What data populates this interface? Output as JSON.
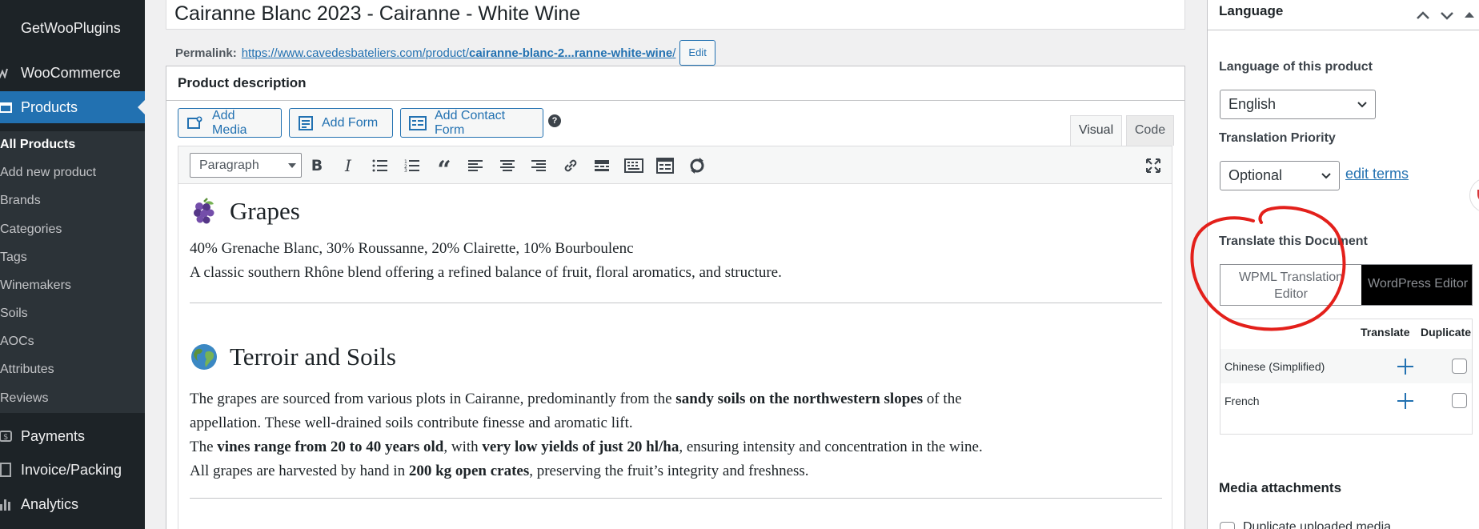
{
  "sidebar": {
    "items": [
      {
        "label": "GetWooPlugins",
        "icon": "getwooplugins-icon"
      },
      {
        "label": "WooCommerce",
        "icon": "woocommerce-icon"
      },
      {
        "label": "Products",
        "icon": "products-icon"
      }
    ],
    "submenu": [
      {
        "label": "All Products"
      },
      {
        "label": "Add new product"
      },
      {
        "label": "Brands"
      },
      {
        "label": "Categories"
      },
      {
        "label": "Tags"
      },
      {
        "label": "Winemakers"
      },
      {
        "label": "Soils"
      },
      {
        "label": "AOCs"
      },
      {
        "label": "Attributes"
      },
      {
        "label": "Reviews"
      }
    ],
    "bottom_items": [
      {
        "label": "Payments",
        "icon": "payments-icon"
      },
      {
        "label": "Invoice/Packing",
        "icon": "invoice-icon"
      },
      {
        "label": "Analytics",
        "icon": "analytics-icon"
      }
    ]
  },
  "product": {
    "title": "Cairanne Blanc 2023 - Cairanne - White Wine",
    "permalink_label": "Permalink:",
    "permalink_base": "https://www.cavedesbateliers.com/product/",
    "permalink_slug": "cairanne-blanc-2...ranne-white-wine",
    "permalink_trailing": "/",
    "permalink_edit": "Edit"
  },
  "description": {
    "header": "Product description",
    "buttons": {
      "add_media": "Add Media",
      "add_form": "Add Form",
      "add_contact_form": "Add Contact Form",
      "help": "?"
    },
    "tabs": {
      "visual": "Visual",
      "code": "Code"
    },
    "format_select": "Paragraph",
    "content": {
      "grapes_title": "Grapes",
      "grapes_line1": "40% Grenache Blanc, 30% Roussanne, 20% Clairette, 10% Bourboulenc",
      "grapes_line2": "A classic southern Rhône blend offering a refined balance of fruit, floral aromatics, and structure.",
      "terroir_title": "Terroir and Soils",
      "p1_a": "The grapes are sourced from various plots in Cairanne, predominantly from the ",
      "p1_b": "sandy soils on the northwestern slopes",
      "p1_c": " of the",
      "p2": "appellation. These well-drained soils contribute finesse and aromatic lift.",
      "p3_a": "The ",
      "p3_b": "vines range from 20 to 40 years old",
      "p3_c": ", with ",
      "p3_d": "very low yields of just 20 hl/ha",
      "p3_e": ", ensuring intensity and concentration in the wine.",
      "p4_a": "All grapes are harvested by hand in ",
      "p4_b": "200 kg open crates",
      "p4_c": ", preserving the fruit’s integrity and freshness."
    }
  },
  "language_panel": {
    "title": "Language",
    "language_label": "Language of this product",
    "language_value": "English",
    "priority_label": "Translation Priority",
    "priority_value": "Optional",
    "edit_terms": "edit terms",
    "translate_label": "Translate this Document",
    "editor_options": [
      "WPML Translation Editor",
      "WordPress Editor"
    ],
    "table_headers": {
      "translate": "Translate",
      "duplicate": "Duplicate"
    },
    "languages": [
      {
        "name": "Chinese (Simplified)"
      },
      {
        "name": "French"
      }
    ],
    "media_attachments": "Media attachments",
    "partial_text": "Duplicate uploaded media"
  },
  "colors": {
    "sidebar_bg": "#1d2327",
    "accent": "#2271b1",
    "annotation": "#e3201b"
  }
}
